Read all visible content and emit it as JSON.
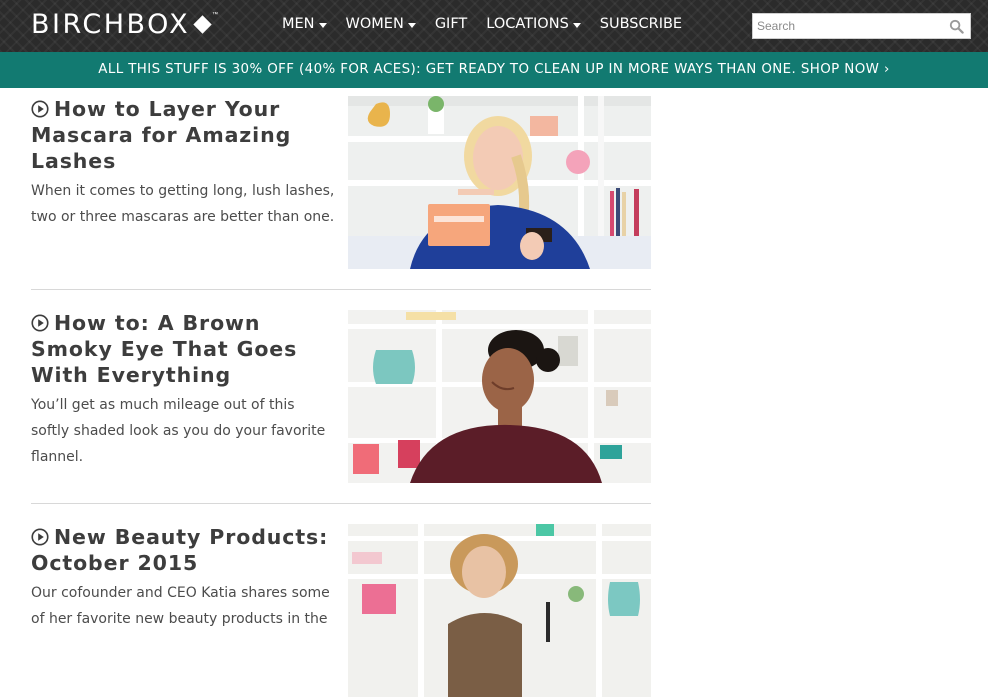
{
  "header": {
    "logo": "BIRCHBOX",
    "logo_tm": "™",
    "nav": [
      {
        "label": "MEN",
        "dropdown": true
      },
      {
        "label": "WOMEN",
        "dropdown": true
      },
      {
        "label": "GIFT",
        "dropdown": false
      },
      {
        "label": "LOCATIONS",
        "dropdown": true
      },
      {
        "label": "SUBSCRIBE",
        "dropdown": false
      }
    ],
    "search": {
      "placeholder": "Search",
      "icon": "search-icon"
    }
  },
  "promo": {
    "text": "ALL THIS STUFF IS 30% OFF (40% FOR ACES): GET READY TO CLEAN UP IN MORE WAYS THAN ONE. SHOP NOW ›"
  },
  "articles": [
    {
      "title": "How to Layer Your Mascara for Amazing Lashes",
      "description": "When it comes to getting long, lush lashes, two or three mascaras are better than one.",
      "icon": "play-circle-icon"
    },
    {
      "title": "How to: A Brown Smoky Eye That Goes With Everything",
      "description": "You’ll get as much mileage out of this softly shaded look as you do your favorite flannel.",
      "icon": "play-circle-icon"
    },
    {
      "title": "New Beauty Products: October 2015",
      "description": "Our cofounder and CEO Katia shares some of her favorite new beauty products in the",
      "icon": "play-circle-icon"
    }
  ],
  "colors": {
    "header_bg": "#2b2b2b",
    "promo_bg": "#127a71",
    "text": "#3d3d3d"
  }
}
